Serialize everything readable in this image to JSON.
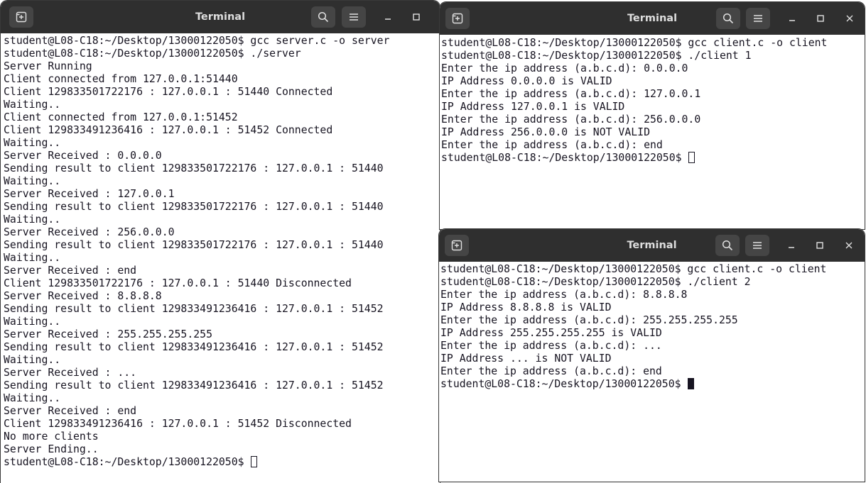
{
  "windows": {
    "server": {
      "title": "Terminal",
      "lines": [
        "student@L08-C18:~/Desktop/13000122050$ gcc server.c -o server",
        "student@L08-C18:~/Desktop/13000122050$ ./server",
        "Server Running",
        "Client connected from 127.0.0.1:51440",
        "Client 129833501722176 : 127.0.0.1 : 51440 Connected",
        "Waiting..",
        "Client connected from 127.0.0.1:51452",
        "Client 129833491236416 : 127.0.0.1 : 51452 Connected",
        "Waiting..",
        "Server Received : 0.0.0.0",
        "Sending result to client 129833501722176 : 127.0.0.1 : 51440",
        "Waiting..",
        "Server Received : 127.0.0.1",
        "Sending result to client 129833501722176 : 127.0.0.1 : 51440",
        "Waiting..",
        "Server Received : 256.0.0.0",
        "Sending result to client 129833501722176 : 127.0.0.1 : 51440",
        "Waiting..",
        "Server Received : end",
        "Client 129833501722176 : 127.0.0.1 : 51440 Disconnected",
        "Server Received : 8.8.8.8",
        "Sending result to client 129833491236416 : 127.0.0.1 : 51452",
        "Waiting..",
        "Server Received : 255.255.255.255",
        "Sending result to client 129833491236416 : 127.0.0.1 : 51452",
        "Waiting..",
        "Server Received : ...",
        "Sending result to client 129833491236416 : 127.0.0.1 : 51452",
        "Waiting..",
        "Server Received : end",
        "Client 129833491236416 : 127.0.0.1 : 51452 Disconnected",
        "No more clients",
        "Server Ending..",
        "student@L08-C18:~/Desktop/13000122050$ "
      ],
      "cursor_style": "hollow"
    },
    "client1": {
      "title": "Terminal",
      "lines": [
        "student@L08-C18:~/Desktop/13000122050$ gcc client.c -o client",
        "student@L08-C18:~/Desktop/13000122050$ ./client 1",
        "Enter the ip address (a.b.c.d): 0.0.0.0",
        "IP Address 0.0.0.0 is VALID",
        "Enter the ip address (a.b.c.d): 127.0.0.1",
        "IP Address 127.0.0.1 is VALID",
        "Enter the ip address (a.b.c.d): 256.0.0.0",
        "IP Address 256.0.0.0 is NOT VALID",
        "Enter the ip address (a.b.c.d): end",
        "student@L08-C18:~/Desktop/13000122050$ "
      ],
      "cursor_style": "hollow"
    },
    "client2": {
      "title": "Terminal",
      "lines": [
        "student@L08-C18:~/Desktop/13000122050$ gcc client.c -o client",
        "student@L08-C18:~/Desktop/13000122050$ ./client 2",
        "Enter the ip address (a.b.c.d): 8.8.8.8",
        "IP Address 8.8.8.8 is VALID",
        "Enter the ip address (a.b.c.d): 255.255.255.255",
        "IP Address 255.255.255.255 is VALID",
        "Enter the ip address (a.b.c.d): ...",
        "IP Address ... is NOT VALID",
        "Enter the ip address (a.b.c.d): end",
        "student@L08-C18:~/Desktop/13000122050$ "
      ],
      "cursor_style": "solid"
    }
  },
  "icons": {
    "new_tab": "new-tab-icon",
    "search": "search-icon",
    "menu": "hamburger-menu-icon",
    "minimize": "minimize-icon",
    "maximize": "maximize-icon",
    "close": "close-icon"
  },
  "colors": {
    "titlebar": "#2f2f2f",
    "button": "#454545",
    "terminal_bg": "#ffffff",
    "terminal_fg": "#171421"
  }
}
